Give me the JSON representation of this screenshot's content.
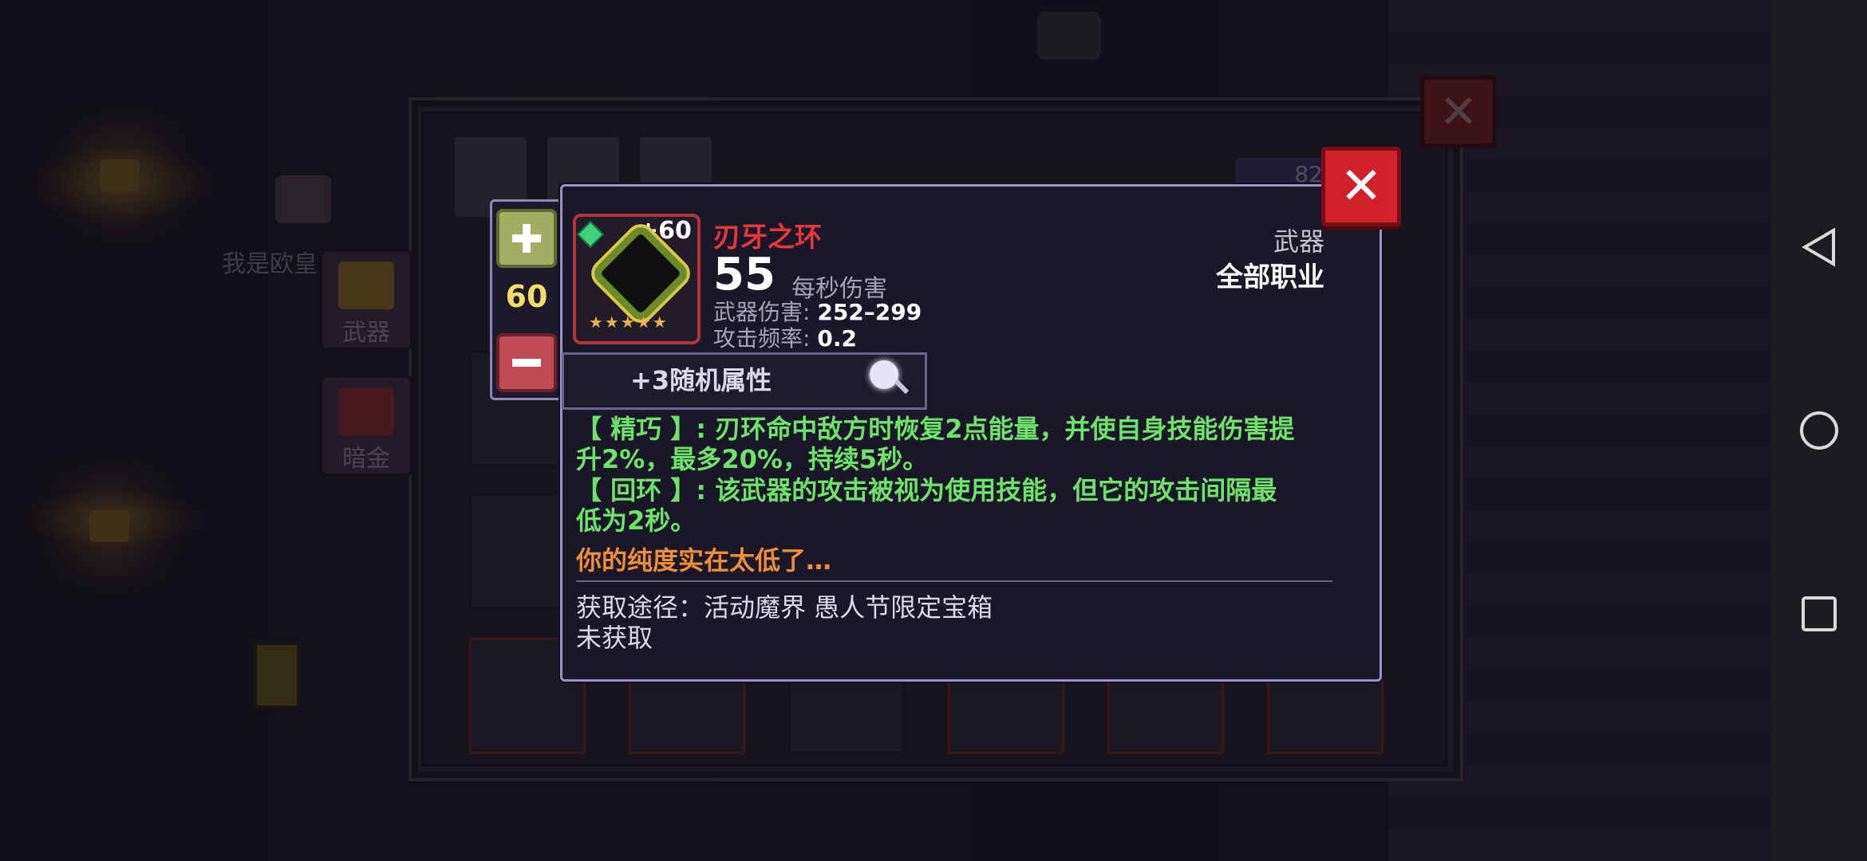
{
  "background": {
    "player_name": "我是欧皇",
    "side_buttons": [
      {
        "label": "武器"
      },
      {
        "label": "暗金"
      }
    ],
    "count_chip": "82"
  },
  "level_control": {
    "value": "60"
  },
  "item": {
    "name": "刃牙之环",
    "level_bonus": "+60",
    "stars": "★★★★★",
    "dps": "55",
    "dps_label": "每秒伤害",
    "damage_label": "武器伤害:",
    "damage_value": "252–299",
    "rate_label": "攻击频率:",
    "rate_value": "0.2",
    "category": "武器",
    "class": "全部职业",
    "random_attr": "+3随机属性",
    "desc_1a": "【 精巧 】: 刃环命中敌方时恢复2点能量，并使自身技能伤害提",
    "desc_1b": "升2%，最多20%，持续5秒。",
    "desc_2a": "【 回环 】: 该武器的攻击被视为使用技能，但它的攻击间隔最",
    "desc_2b": "低为2秒。",
    "warning": "你的纯度实在太低了…",
    "source": "获取途径：活动魔界 愚人节限定宝箱",
    "status": "未获取"
  },
  "colors": {
    "item_name": "#e8363d",
    "desc_text": "#6fe26b",
    "warning": "#ef8e3a",
    "close_button": "#d1212b"
  },
  "icons": [
    "close-icon",
    "plus-icon",
    "minus-icon",
    "magnifier-icon",
    "back-triangle-icon",
    "home-circle-icon",
    "recents-square-icon"
  ]
}
